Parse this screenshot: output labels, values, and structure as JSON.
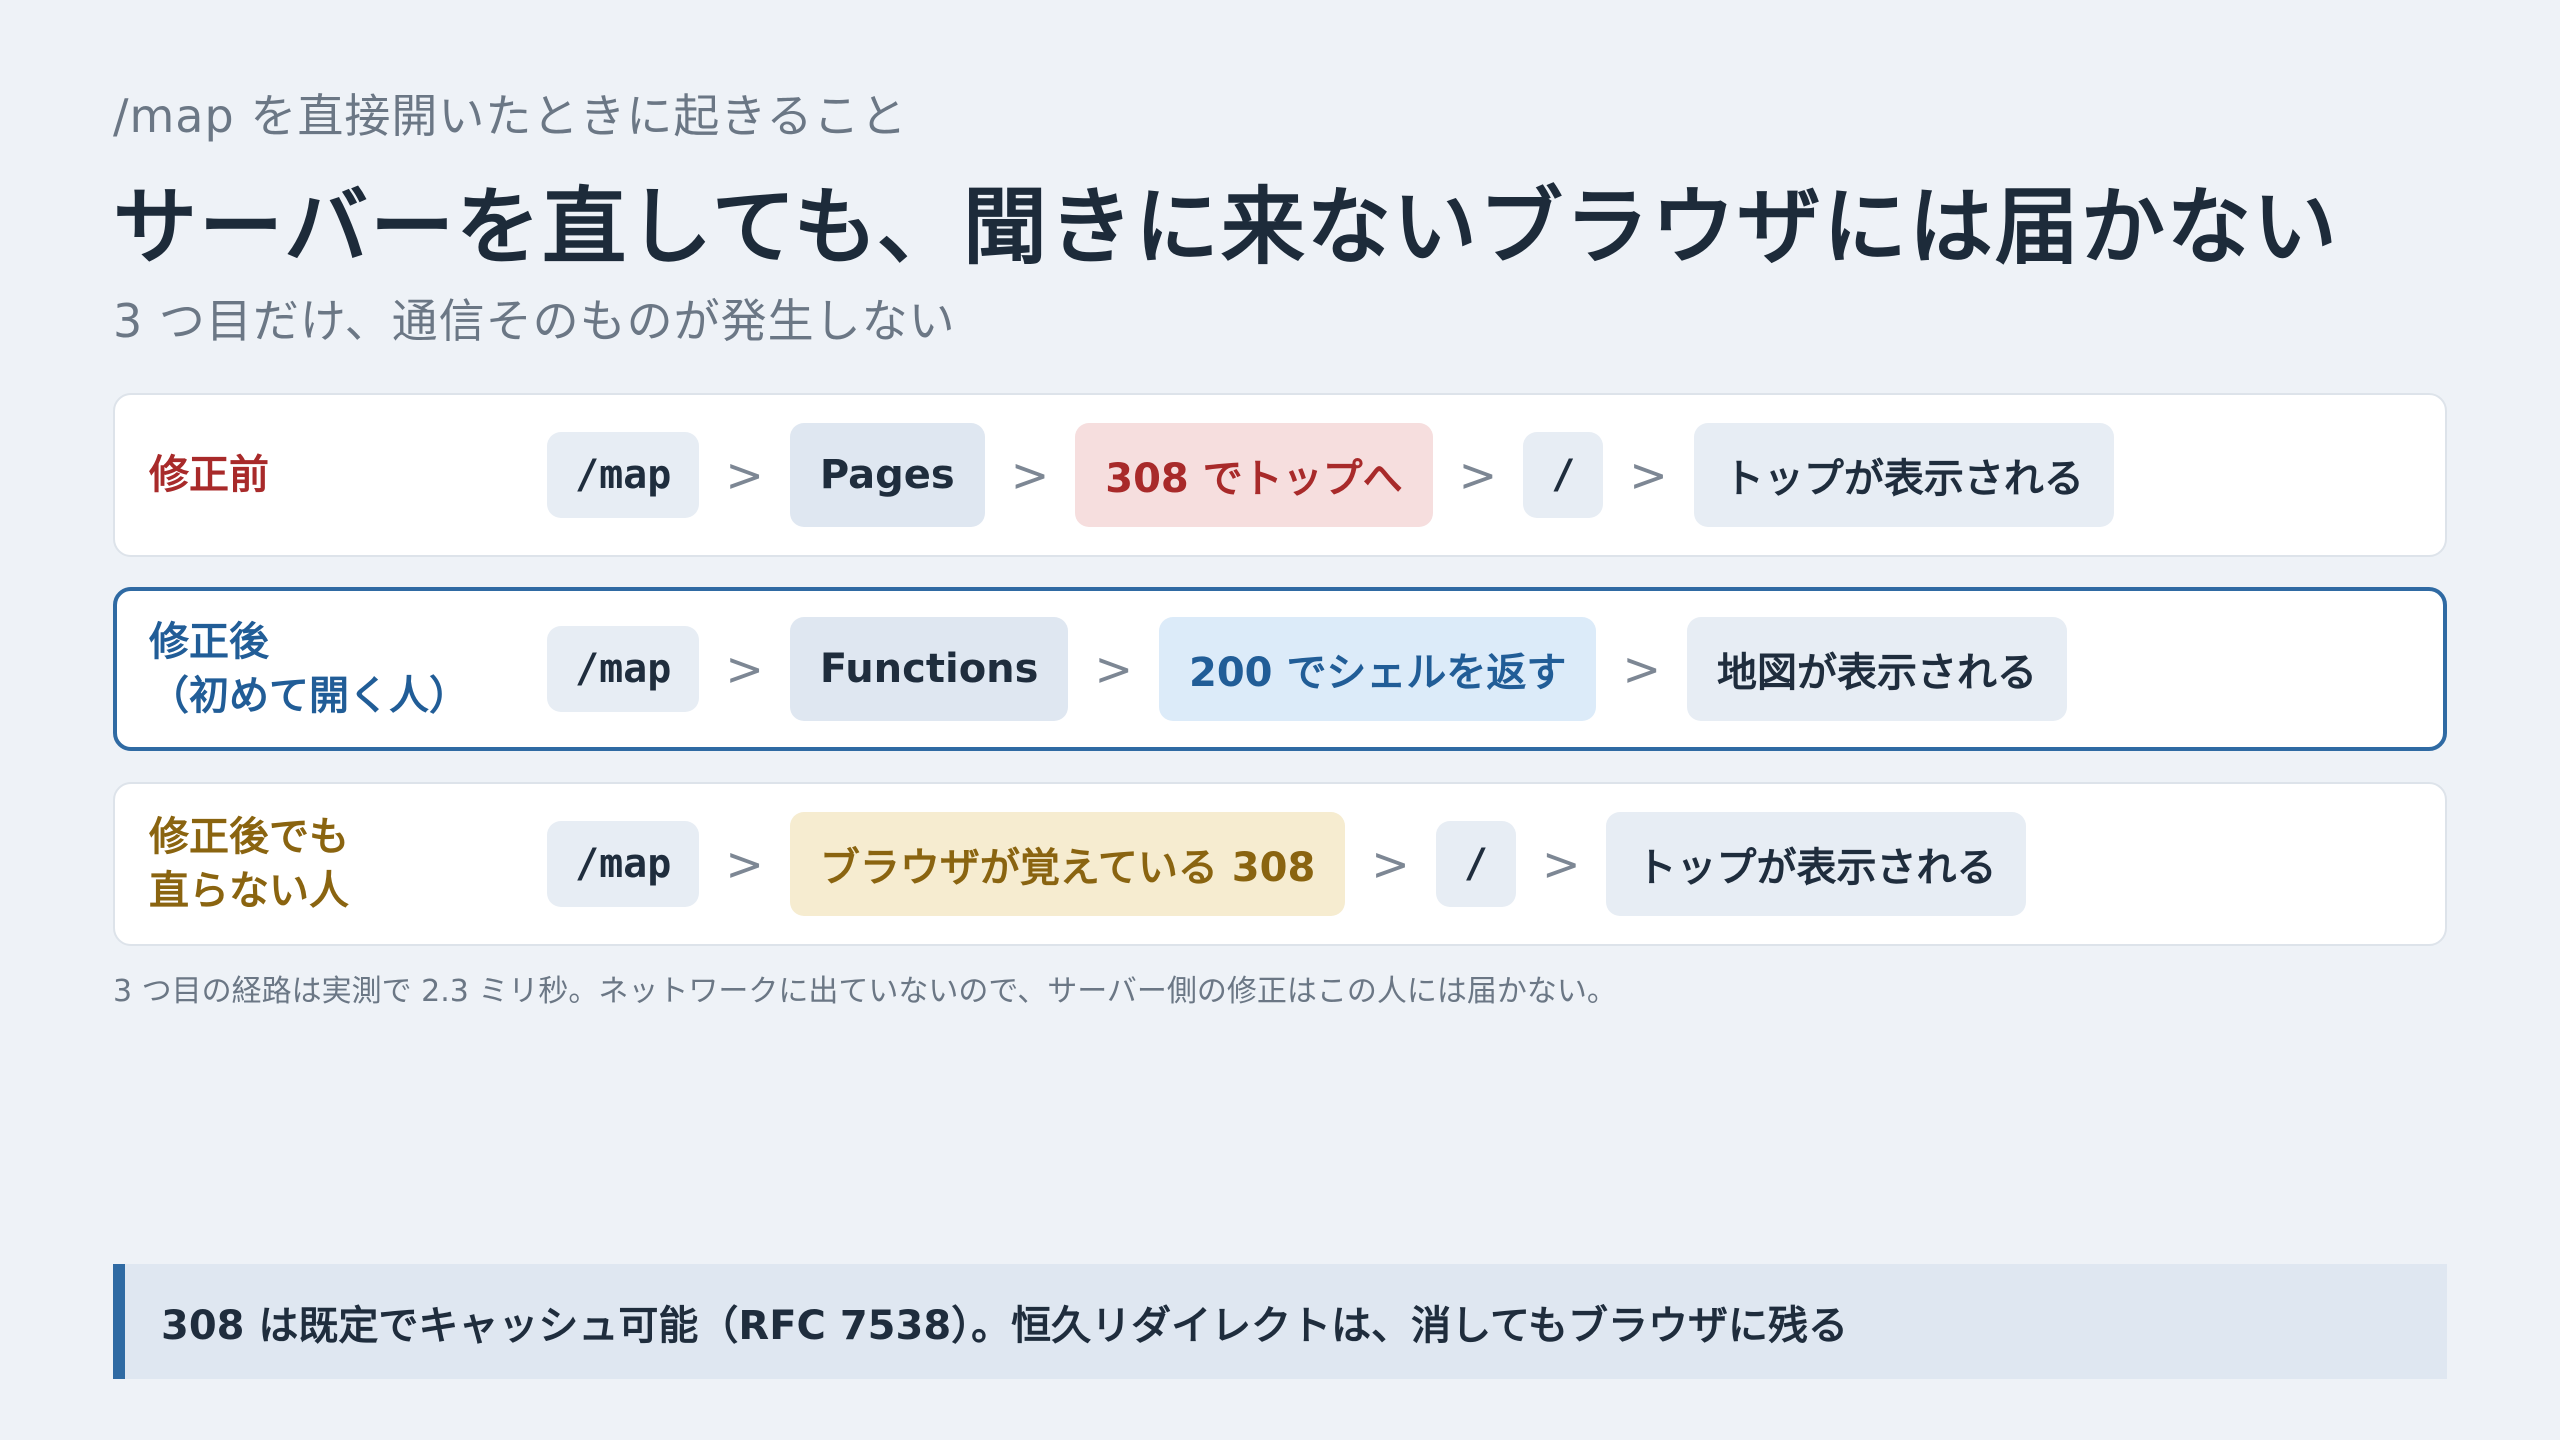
{
  "header": {
    "eyebrow": "/map を直接開いたときに起きること",
    "title": "サーバーを直しても、聞きに来ないブラウザには届かない",
    "subtitle": "3 つ目だけ、通信そのものが発生しない"
  },
  "arrow_glyph": ">",
  "rows": [
    {
      "label": "修正前",
      "label_color": "#a82a2a",
      "steps": [
        "/map",
        "Pages",
        "308 でトップへ",
        "/",
        "トップが表示される"
      ]
    },
    {
      "label": "修正後\n（初めて開く人）",
      "label_color": "#215d97",
      "steps": [
        "/map",
        "Functions",
        "200 でシェルを返す",
        "地図が表示される"
      ]
    },
    {
      "label": "修正後でも\n直らない人",
      "label_color": "#8a6410",
      "steps": [
        "/map",
        "ブラウザが覚えている 308",
        "/",
        "トップが表示される"
      ]
    }
  ],
  "note": "3 つ目の経路は実測で 2.3 ミリ秒。ネットワークに出ていないので、サーバー側の修正はこの人には届かない。",
  "callout": "308 は既定でキャッシュ可能（RFC 7538）。恒久リダイレクトは、消してもブラウザに残る",
  "colors": {
    "accent": "#2f6aa3",
    "red_chip_bg": "#f6dede",
    "blue_chip_bg": "#dcebf9",
    "yellow_chip_bg": "#f6ecd0",
    "neutral_chip_bg": "#dfe7f1"
  }
}
